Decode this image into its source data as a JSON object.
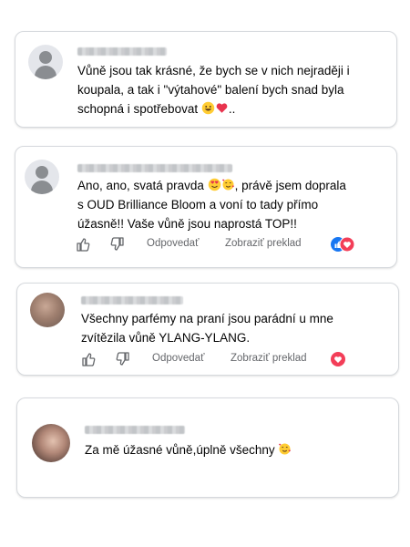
{
  "comments": [
    {
      "text_line1": "Vůně jsou tak krásné, že bych se v nich nejraději i",
      "text_line2": "koupala, a tak i \"výtahové\" balení bych snad byla",
      "text_line3": "schopná i spotřebovat",
      "text_line3_suffix": ".."
    },
    {
      "text_line1_prefix": "Ano, ano, svatá pravda",
      "text_line1_suffix": ", právě jsem doprala",
      "text_line2": "s OUD Brilliance Bloom a voní to tady přímo",
      "text_line3": "úžasně!! Vaše vůně jsou naprostá TOP!!",
      "reply_label": "Odpovedať",
      "translate_label": "Zobraziť preklad"
    },
    {
      "text_line1": "Všechny parfémy na praní jsou parádní u mne",
      "text_line2": "zvítězila vůně YLANG-YLANG.",
      "reply_label": "Odpovedať",
      "translate_label": "Zobraziť preklad"
    },
    {
      "text_line1": "Za mě úžasné vůně,úplně všechny"
    }
  ],
  "colors": {
    "like_blue": "#1877f2",
    "love_red": "#f33e58",
    "meta_gray": "#65676b"
  },
  "icons": [
    "thumbs-up-icon",
    "thumbs-down-icon",
    "like-reaction-icon",
    "love-reaction-icon",
    "grinning-emoji",
    "hearts-emoji",
    "heart-eyes-emoji",
    "smiling-hearts-emoji"
  ]
}
